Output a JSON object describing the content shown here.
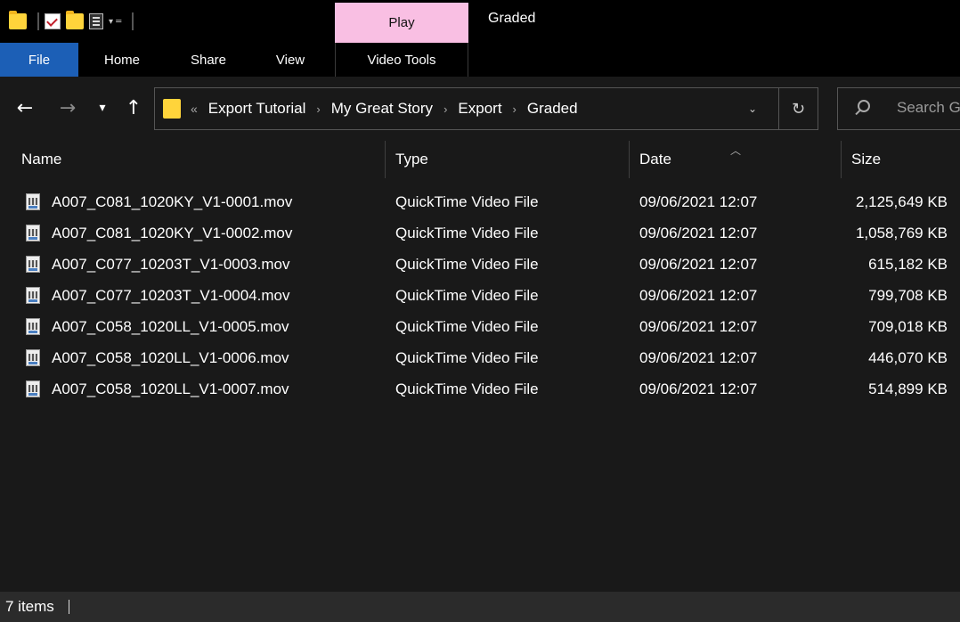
{
  "window": {
    "title": "Graded"
  },
  "ribbon": {
    "contextual_tab": "Play",
    "tabs": [
      {
        "label": "File"
      },
      {
        "label": "Home"
      },
      {
        "label": "Share"
      },
      {
        "label": "View"
      },
      {
        "label": "Video Tools"
      }
    ]
  },
  "address": {
    "overflow_glyph": "«",
    "crumbs": [
      "Export Tutorial",
      "My Great Story",
      "Export",
      "Graded"
    ]
  },
  "search": {
    "placeholder": "Search G"
  },
  "columns": {
    "name": "Name",
    "type": "Type",
    "date": "Date",
    "size": "Size"
  },
  "files": [
    {
      "name": "A007_C081_1020KY_V1-0001.mov",
      "type": "QuickTime Video File",
      "date": "09/06/2021 12:07",
      "size": "2,125,649 KB"
    },
    {
      "name": "A007_C081_1020KY_V1-0002.mov",
      "type": "QuickTime Video File",
      "date": "09/06/2021 12:07",
      "size": "1,058,769 KB"
    },
    {
      "name": "A007_C077_10203T_V1-0003.mov",
      "type": "QuickTime Video File",
      "date": "09/06/2021 12:07",
      "size": "615,182 KB"
    },
    {
      "name": "A007_C077_10203T_V1-0004.mov",
      "type": "QuickTime Video File",
      "date": "09/06/2021 12:07",
      "size": "799,708 KB"
    },
    {
      "name": "A007_C058_1020LL_V1-0005.mov",
      "type": "QuickTime Video File",
      "date": "09/06/2021 12:07",
      "size": "709,018 KB"
    },
    {
      "name": "A007_C058_1020LL_V1-0006.mov",
      "type": "QuickTime Video File",
      "date": "09/06/2021 12:07",
      "size": "446,070 KB"
    },
    {
      "name": "A007_C058_1020LL_V1-0007.mov",
      "type": "QuickTime Video File",
      "date": "09/06/2021 12:07",
      "size": "514,899 KB"
    }
  ],
  "status": {
    "item_count": "7 items"
  },
  "colors": {
    "accent": "#1c5fb6",
    "contextual_tab": "#f9bfe3",
    "folder": "#ffd43b",
    "background": "#191919"
  }
}
